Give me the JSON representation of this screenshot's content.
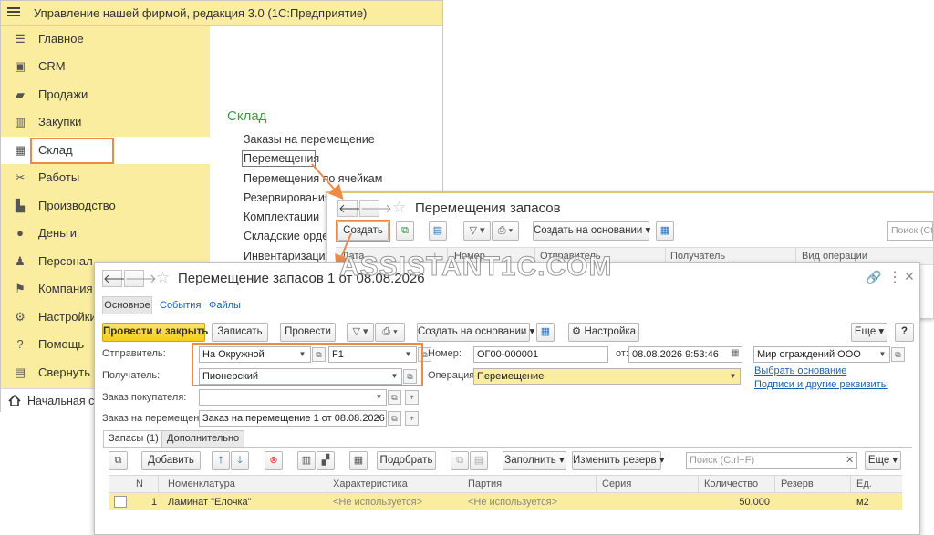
{
  "app": {
    "title": "Управление нашей фирмой, редакция 3.0  (1С:Предприятие)",
    "home_tab_label": "Начальная ст"
  },
  "sidebar": {
    "items": [
      {
        "label": "Главное",
        "icon": "menu-lines-icon"
      },
      {
        "label": "CRM",
        "icon": "crm-icon"
      },
      {
        "label": "Продажи",
        "icon": "sales-icon"
      },
      {
        "label": "Закупки",
        "icon": "purchases-icon"
      },
      {
        "label": "Склад",
        "icon": "warehouse-icon"
      },
      {
        "label": "Работы",
        "icon": "tools-icon"
      },
      {
        "label": "Производство",
        "icon": "factory-icon"
      },
      {
        "label": "Деньги",
        "icon": "money-icon"
      },
      {
        "label": "Персонал",
        "icon": "person-icon"
      },
      {
        "label": "Компания",
        "icon": "flag-icon"
      },
      {
        "label": "Настройки",
        "icon": "gear-icon"
      },
      {
        "label": "Помощь",
        "icon": "help-icon"
      },
      {
        "label": "Свернуть",
        "icon": "collapse-icon"
      }
    ],
    "active_item": "Склад"
  },
  "section": {
    "title": "Склад",
    "links": [
      "Заказы на перемещение",
      "Перемещения",
      "Перемещения по ячейкам",
      "Резервирования",
      "Комплектации",
      "Складские ордер",
      "Инвентаризации"
    ]
  },
  "list_window": {
    "title": "Перемещения запасов",
    "create_button": "Создать",
    "create_based_on": "Создать на основании",
    "search_placeholder": "Поиск (Ctrl",
    "columns": [
      "Дата",
      "Номер",
      "Отправитель",
      "Получатель",
      "Вид операции"
    ]
  },
  "doc": {
    "title": "Перемещение запасов 1 от 08.08.2026",
    "tabs": {
      "main": "Основное",
      "events": "События",
      "files": "Файлы"
    },
    "toolbar": {
      "post_close": "Провести и закрыть",
      "save": "Записать",
      "post": "Провести",
      "create_based_on": "Создать на основании",
      "settings": "Настройка",
      "more": "Еще",
      "help": "?"
    },
    "fields": {
      "sender_label": "Отправитель:",
      "sender_value": "На Окружной",
      "sender_cell": "F1",
      "receiver_label": "Получатель:",
      "receiver_value": "Пионерский",
      "buyer_order_label": "Заказ покупателя:",
      "buyer_order_value": "",
      "transfer_order_label": "Заказ на перемещение:",
      "transfer_order_value": "Заказ на перемещение 1 от 08.08.2026",
      "number_label": "Номер:",
      "number_value": "ОГ00-000001",
      "date_label": "от:",
      "date_value": "08.08.2026  9:53:46",
      "company_value": "Мир ограждений ООО",
      "operation_label": "Операция:",
      "operation_value": "Перемещение"
    },
    "links": {
      "select_basis": "Выбрать основание",
      "signatures": "Подписи и другие реквизиты"
    },
    "subtabs": {
      "stock": "Запасы (1)",
      "additional": "Дополнительно"
    },
    "table_toolbar": {
      "add": "Добавить",
      "pick": "Подобрать",
      "fill": "Заполнить",
      "change_reserve": "Изменить резерв",
      "search_placeholder": "Поиск (Ctrl+F)",
      "more": "Еще"
    },
    "table": {
      "columns": [
        "N",
        "Номенклатура",
        "Характеристика",
        "Партия",
        "Серия",
        "Количество",
        "Резерв",
        "Ед."
      ],
      "rows": [
        {
          "n": "1",
          "item": "Ламинат \"Елочка\"",
          "characteristic": "<Не используется>",
          "batch": "<Не используется>",
          "series": "",
          "quantity": "50,000",
          "reserve": "",
          "unit": "м2"
        }
      ]
    }
  },
  "watermark": "ASSISTANT1C.COM",
  "colors": {
    "accent_yellow": "#fbeda0",
    "highlight_orange": "#ee8a46",
    "section_green": "#3c9a42",
    "link_blue": "#1b5fb3",
    "primary_button": "#f7d52b"
  }
}
